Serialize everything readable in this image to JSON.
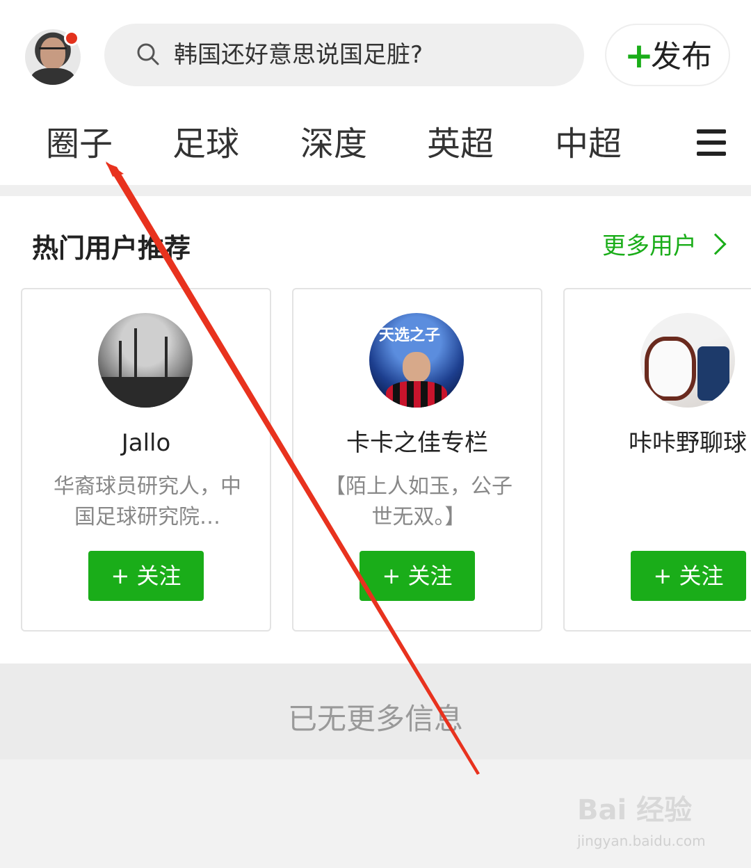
{
  "header": {
    "search_text": "韩国还好意思说国足脏?",
    "publish_plus": "+",
    "publish_label": "发布"
  },
  "tabs": [
    "圈子",
    "足球",
    "深度",
    "英超",
    "中超"
  ],
  "recommend": {
    "title": "热门用户推荐",
    "more_label": "更多用户",
    "cards": [
      {
        "name": "Jallo",
        "desc": "华裔球员研究人，中国足球研究院…",
        "follow": "+ 关注"
      },
      {
        "name": "卡卡之佳专栏",
        "desc": "【陌上人如玉，公子世无双。】",
        "follow": "+ 关注",
        "avatar_text": "天选之子"
      },
      {
        "name": "咔咔野聊球",
        "desc": "",
        "follow": "+ 关注"
      }
    ]
  },
  "footer": {
    "end_text": "已无更多信息"
  },
  "watermark": {
    "logo": "Bai 经验",
    "url": "jingyan.baidu.com"
  },
  "colors": {
    "accent": "#1aad19",
    "notification": "#e3321d",
    "annotation_arrow": "#e8321e"
  }
}
